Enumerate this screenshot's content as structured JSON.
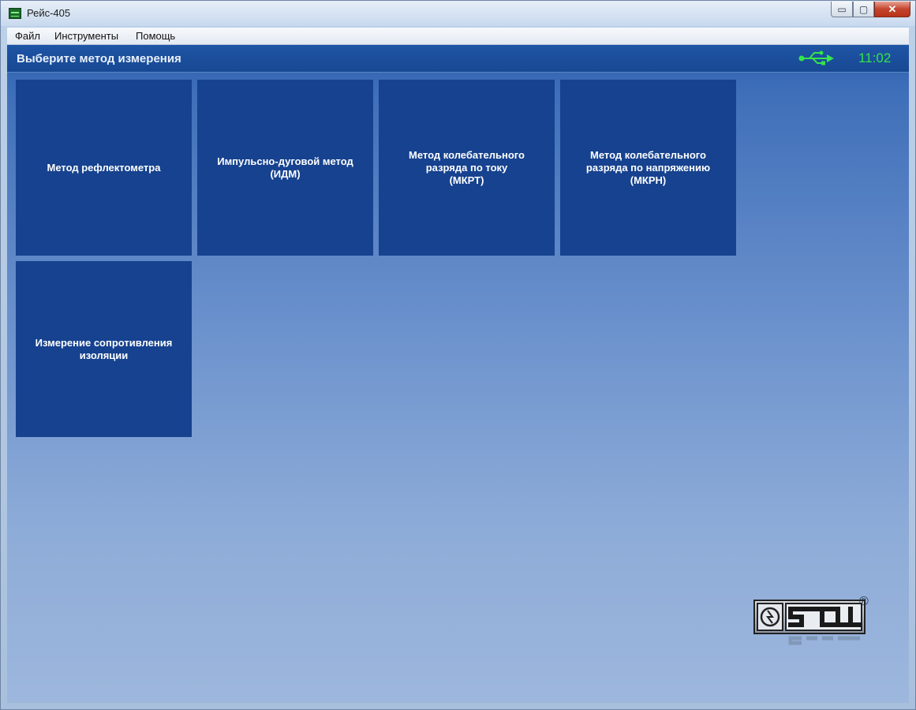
{
  "window": {
    "title": "Рейс-405",
    "controls": {
      "minimize": "▭",
      "maximize": "▢",
      "close": "✕"
    }
  },
  "menu": [
    "Файл",
    "Инструменты",
    "Помощь"
  ],
  "header": {
    "title": "Выберите метод измерения",
    "clock": "11:02",
    "usb_icon": "usb-icon",
    "clock_color": "#35e44a"
  },
  "tiles": [
    {
      "label": "Метод рефлектометра"
    },
    {
      "label": "Импульсно-дуговой метод\n(ИДМ)"
    },
    {
      "label": "Метод колебательного\nразряда по току\n(МКРТ)"
    },
    {
      "label": "Метод колебательного\nразряда по напряжению\n(МКРН)"
    },
    {
      "label": "Измерение сопротивления\nизоляции"
    }
  ],
  "logo": {
    "text": "STELL",
    "registered": "®"
  },
  "colors": {
    "tile": "#16428f",
    "header": "#1f55a6"
  }
}
